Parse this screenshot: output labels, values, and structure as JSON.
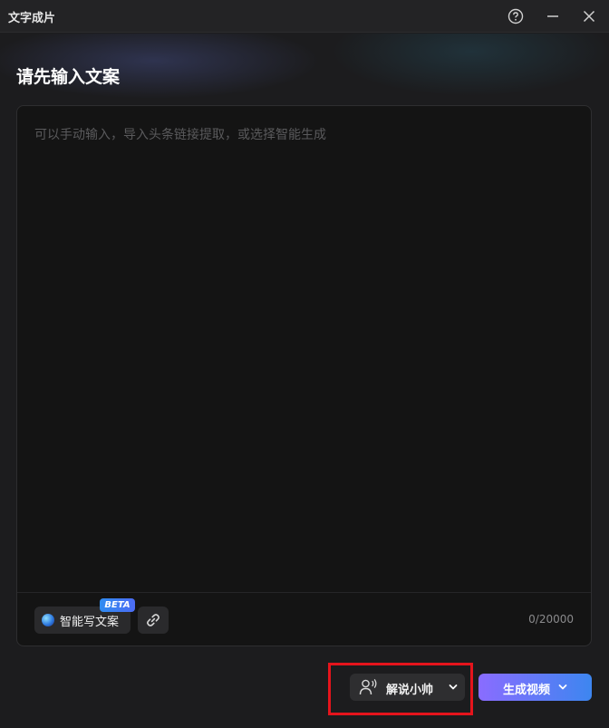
{
  "window": {
    "title": "文字成片",
    "help_icon": "help-circle-icon",
    "minimize_icon": "minimize-icon",
    "close_icon": "close-icon"
  },
  "main": {
    "heading": "请先输入文案",
    "editor": {
      "value": "",
      "placeholder": "可以手动输入，导入头条链接提取，或选择智能生成",
      "counter": "0/20000"
    },
    "toolbar": {
      "ai_write_label": "智能写文案",
      "ai_write_badge": "BETA",
      "link_icon": "link-icon"
    }
  },
  "footer": {
    "voice_select": {
      "value": "解说小帅",
      "icon": "person-voice-icon"
    },
    "generate_button": {
      "label": "生成视频"
    }
  },
  "colors": {
    "background": "#1c1c1e",
    "editor_bg": "#141414",
    "accent_start": "#8a6cff",
    "accent_end": "#3d86f0",
    "highlight": "#e5141c"
  }
}
